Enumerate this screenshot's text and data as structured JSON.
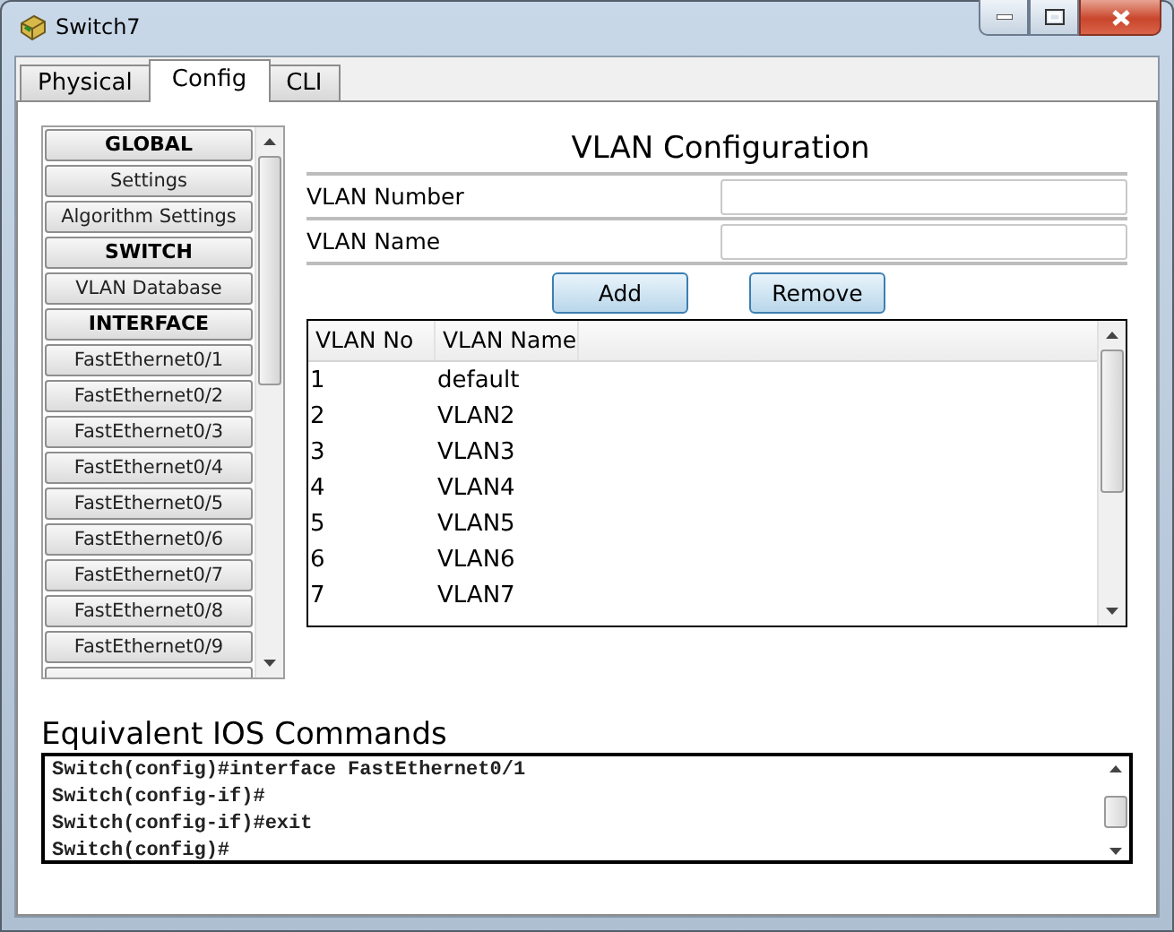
{
  "window": {
    "title": "Switch7"
  },
  "tabs": [
    {
      "label": "Physical",
      "selected": false
    },
    {
      "label": "Config",
      "selected": true
    },
    {
      "label": "CLI",
      "selected": false
    }
  ],
  "sidebar": {
    "items": [
      {
        "label": "GLOBAL",
        "kind": "header"
      },
      {
        "label": "Settings",
        "kind": "item"
      },
      {
        "label": "Algorithm Settings",
        "kind": "item"
      },
      {
        "label": "SWITCH",
        "kind": "header"
      },
      {
        "label": "VLAN Database",
        "kind": "item"
      },
      {
        "label": "INTERFACE",
        "kind": "header"
      },
      {
        "label": "FastEthernet0/1",
        "kind": "item"
      },
      {
        "label": "FastEthernet0/2",
        "kind": "item"
      },
      {
        "label": "FastEthernet0/3",
        "kind": "item"
      },
      {
        "label": "FastEthernet0/4",
        "kind": "item"
      },
      {
        "label": "FastEthernet0/5",
        "kind": "item"
      },
      {
        "label": "FastEthernet0/6",
        "kind": "item"
      },
      {
        "label": "FastEthernet0/7",
        "kind": "item"
      },
      {
        "label": "FastEthernet0/8",
        "kind": "item"
      },
      {
        "label": "FastEthernet0/9",
        "kind": "item"
      }
    ]
  },
  "vlan_configuration": {
    "title": "VLAN Configuration",
    "fields": [
      {
        "label": "VLAN Number"
      },
      {
        "label": "VLAN Name"
      }
    ],
    "buttons": [
      "Add",
      "Remove"
    ],
    "table": {
      "columns": [
        "VLAN No",
        "VLAN Name"
      ],
      "rows": [
        [
          "1",
          "default"
        ],
        [
          "2",
          "VLAN2"
        ],
        [
          "3",
          "VLAN3"
        ],
        [
          "4",
          "VLAN4"
        ],
        [
          "5",
          "VLAN5"
        ],
        [
          "6",
          "VLAN6"
        ],
        [
          "7",
          "VLAN7"
        ]
      ]
    }
  },
  "ios_commands": {
    "title": "Equivalent IOS Commands",
    "lines": [
      "Switch(config)#interface FastEthernet0/1",
      "Switch(config-if)#",
      "Switch(config-if)#exit",
      "Switch(config)#"
    ]
  }
}
